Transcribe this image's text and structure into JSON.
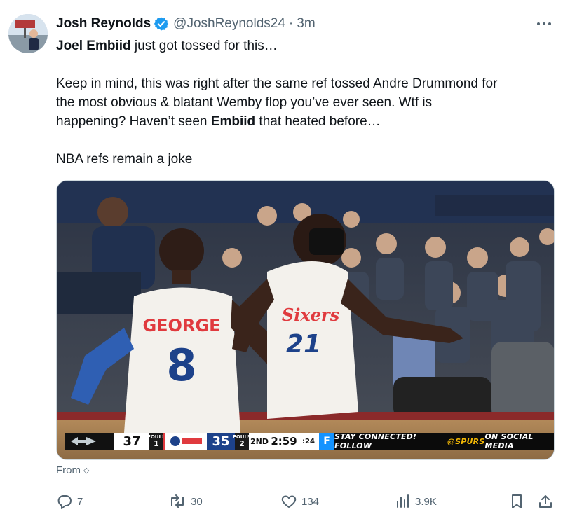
{
  "tweet": {
    "author_name": "Josh Reynolds",
    "handle": "@JoshReynolds24",
    "separator": "·",
    "time": "3m",
    "more_label": "···",
    "line1_bold": "Joel Embiid",
    "line1_rest": " just got tossed for this…",
    "line2": "Keep in mind, this was right after the same ref tossed Andre Drummond for",
    "line3": "the most obvious & blatant Wemby flop you’ve ever seen. Wtf is",
    "line4_pre": "happening? Haven’t seen ",
    "line4_bold": "Embiid",
    "line4_post": " that heated before…",
    "line5": "NBA refs remain a joke",
    "from_label": "From",
    "from_icon": "◇"
  },
  "scoreboard": {
    "team1_logo": "spurs-logo-icon",
    "team1_score": "37",
    "team1_fouls_label": "FOULS",
    "team1_fouls": "1",
    "team2_logo": "76ers-logo-icon",
    "team2_score": "35",
    "team2_fouls_label": "FOULS",
    "team2_fouls": "2",
    "quarter": "2ND",
    "clock": "2:59",
    "shot_clock": ":24",
    "sponsor_icon": "F",
    "ticker_pre": "STAY CONNECTED!  FOLLOW ",
    "ticker_handle": "@SPURS",
    "ticker_post": " ON SOCIAL MEDIA"
  },
  "video_text": {
    "jersey_name": "GEORGE",
    "jersey_number_left": "8",
    "jersey_team": "Sixers",
    "jersey_number_right": "21"
  },
  "actions": {
    "reply_count": "7",
    "retweet_count": "30",
    "like_count": "134",
    "views_count": "3.9K"
  },
  "colors": {
    "verified": "#1d9bf0",
    "text_secondary": "#536471",
    "sixers_blue": "#1d428a",
    "sixers_red": "#e03a3e",
    "spurs_gold": "#f2b705"
  }
}
